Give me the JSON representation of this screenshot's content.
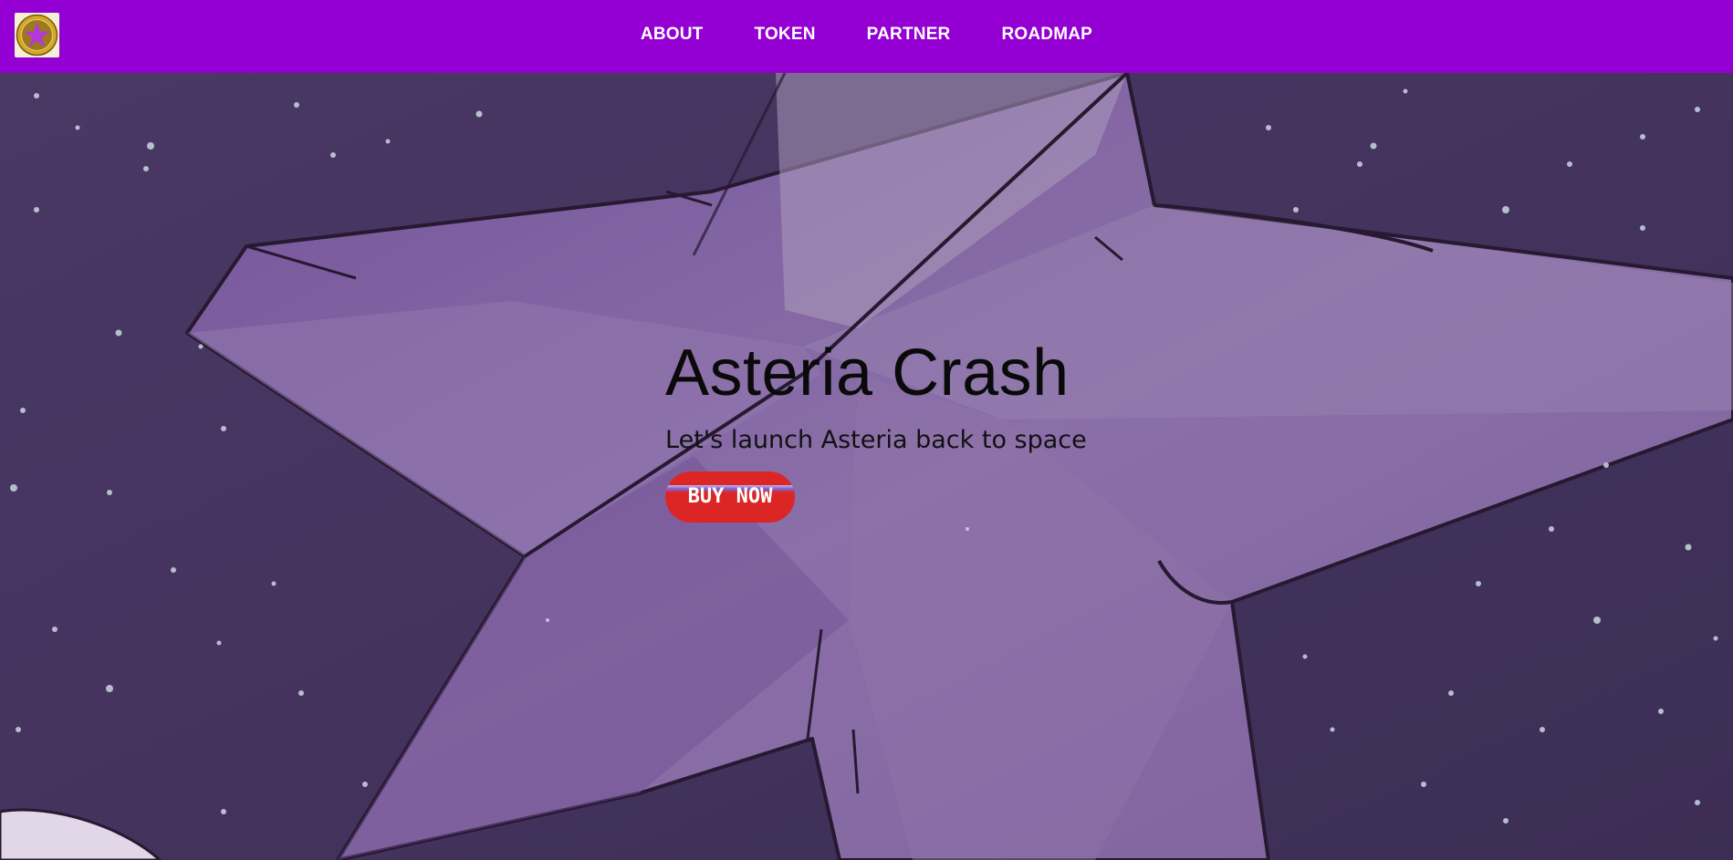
{
  "header": {
    "logo_icon": "star-coin-logo",
    "nav_items": [
      {
        "label": "ABOUT"
      },
      {
        "label": "TOKEN"
      },
      {
        "label": "PARTNER"
      },
      {
        "label": "ROADMAP"
      }
    ]
  },
  "hero": {
    "title": "Asteria Crash",
    "subtitle": "Let's launch Asteria back to space",
    "cta_label": "BUY NOW",
    "background": "starfish-in-space"
  },
  "colors": {
    "navbar": "#9400d3",
    "cta_button": "#dc2626",
    "space_bg": "#3d2a5c",
    "star_fill": "#8a6aa8"
  }
}
